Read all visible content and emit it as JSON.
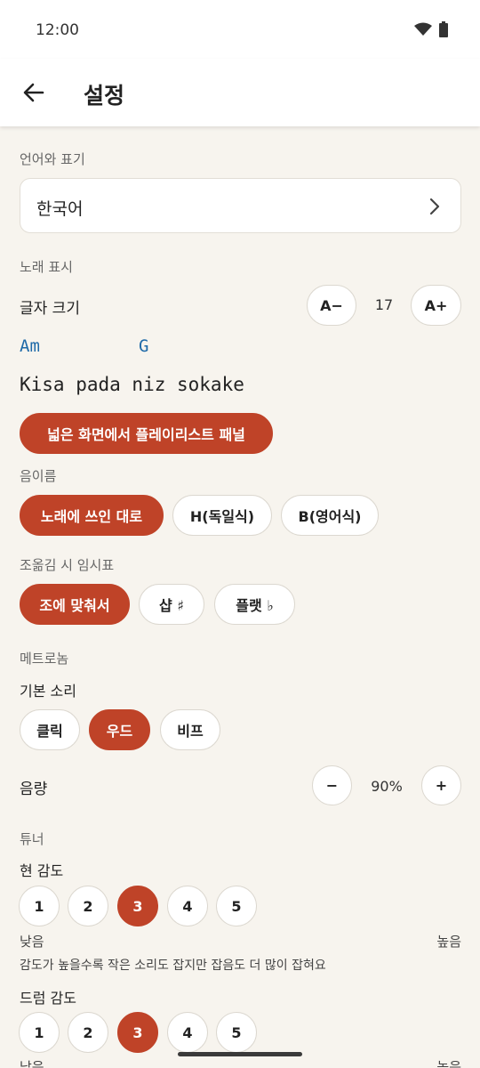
{
  "status_bar": {
    "time": "12:00",
    "icons": [
      "wifi-icon",
      "battery-icon"
    ]
  },
  "app_bar": {
    "title": "설정",
    "back_icon": "arrow-left-icon"
  },
  "language": {
    "section": "언어와 표기",
    "value": "한국어"
  },
  "song_display": {
    "section": "노래 표시",
    "font_size_label": "글자 크기",
    "decrease_label": "A−",
    "font_size_value": "17",
    "increase_label": "A+",
    "preview": {
      "chord1": "Am",
      "chord2": "G",
      "lyric": "Kisa pada niz sokake"
    },
    "wide_screen_toggle": "넓은 화면에서 플레이리스트 패널"
  },
  "note_names": {
    "section": "음이름",
    "options": [
      "노래에 쓰인 대로",
      "H(독일식)",
      "B(영어식)"
    ],
    "selected": 0
  },
  "transpose_accidentals": {
    "section": "조옮김 시 임시표",
    "options": [
      "조에 맞춰서",
      "샵 ♯",
      "플랫 ♭"
    ],
    "selected": 0
  },
  "metronome": {
    "section": "메트로놈",
    "sound_label": "기본 소리",
    "sounds": [
      "클릭",
      "우드",
      "비프"
    ],
    "selected": 1,
    "volume_label": "음량",
    "volume_minus": "−",
    "volume_value": "90%",
    "volume_plus": "+"
  },
  "tuner": {
    "section": "튜너",
    "string_sensitivity": {
      "label": "현 감도",
      "levels": [
        "1",
        "2",
        "3",
        "4",
        "5"
      ],
      "selected": 2,
      "low": "낮음",
      "high": "높음",
      "hint": "감도가 높을수록 작은 소리도 잡지만 잡음도 더 많이 잡혀요"
    },
    "drum_sensitivity": {
      "label": "드럼 감도",
      "levels": [
        "1",
        "2",
        "3",
        "4",
        "5"
      ],
      "selected": 2,
      "low": "낮음",
      "high": "높음"
    }
  },
  "colors": {
    "accent": "#bf4328",
    "chord": "#1f6aa8",
    "background": "#f7f4ee"
  }
}
